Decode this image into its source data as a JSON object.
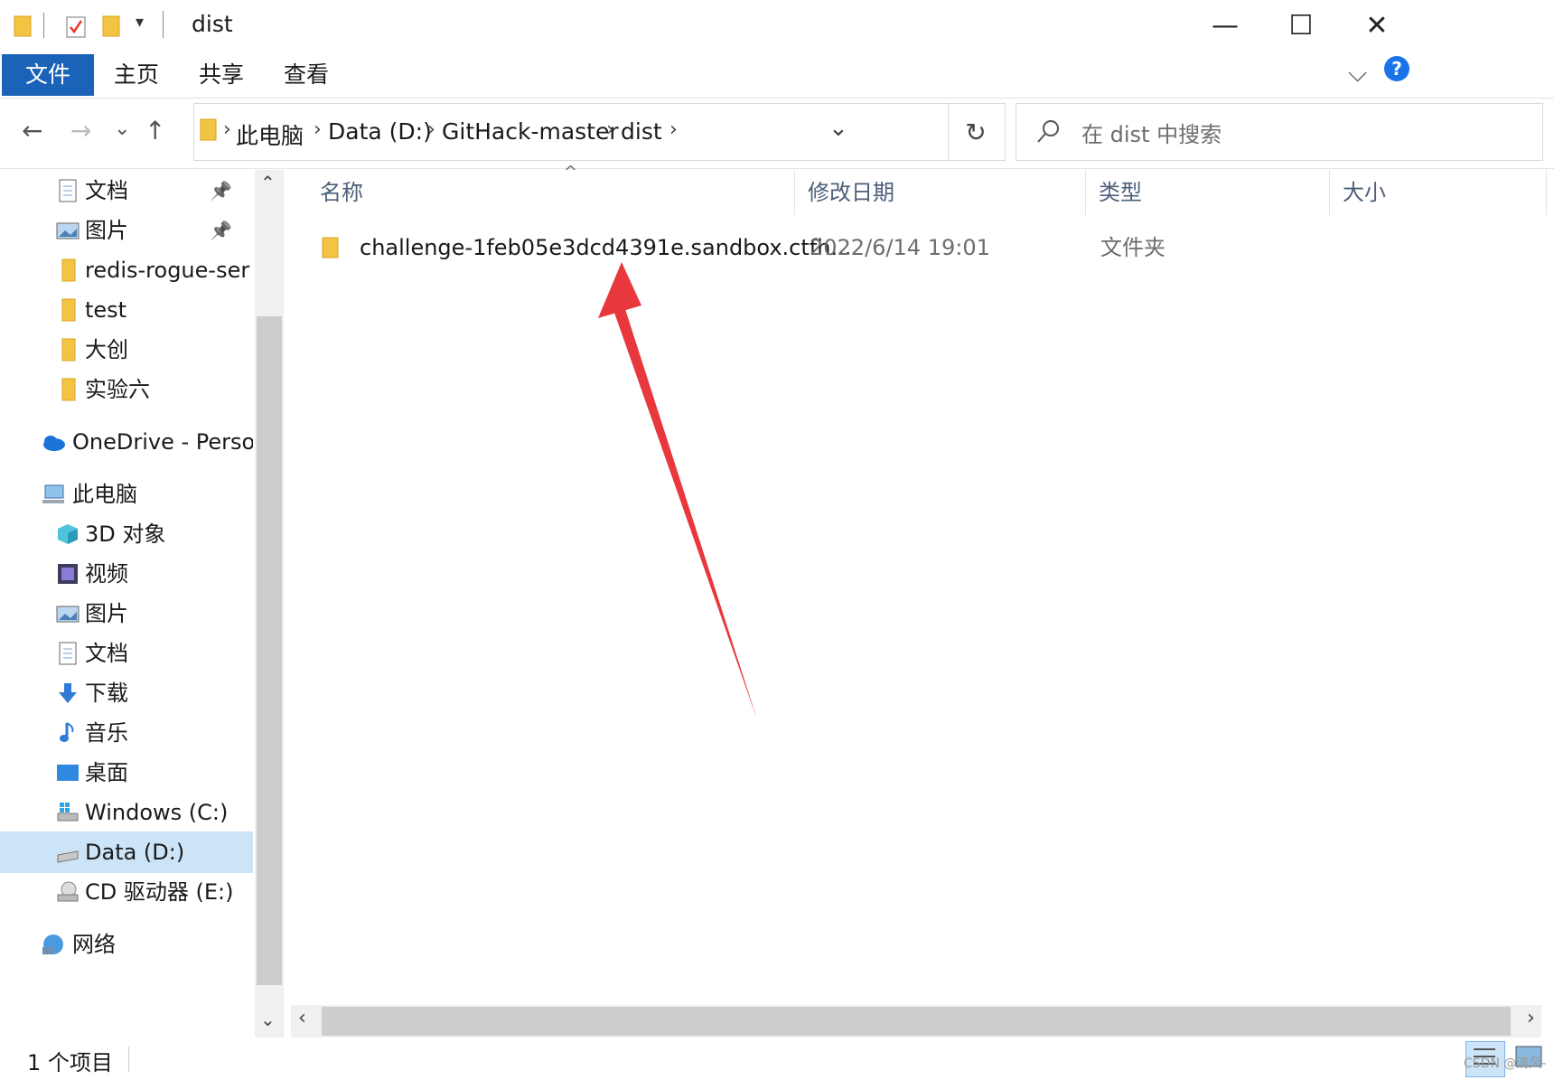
{
  "window": {
    "title": "dist",
    "quick_access": [
      "folder-icon",
      "checkbox-icon",
      "folder-icon",
      "dropdown-icon"
    ],
    "controls": {
      "minimize": "—",
      "maximize": "☐",
      "close": "✕"
    }
  },
  "ribbon": {
    "tabs": [
      {
        "label": "文件",
        "active": true
      },
      {
        "label": "主页",
        "active": false
      },
      {
        "label": "共享",
        "active": false
      },
      {
        "label": "查看",
        "active": false
      }
    ],
    "expand_icon": "⌵",
    "help_icon": "?"
  },
  "nav": {
    "back": "←",
    "forward": "→",
    "recent": "⌄",
    "up": "↑"
  },
  "address": {
    "crumbs": [
      "此电脑",
      "Data (D:)",
      "GitHack-master",
      "dist"
    ],
    "dropdown": "⌄",
    "refresh": "↻"
  },
  "search": {
    "placeholder": "在 dist 中搜索"
  },
  "sidebar": {
    "items": [
      {
        "label": "文档",
        "icon": "document-icon",
        "pinned": true,
        "indent": 1
      },
      {
        "label": "图片",
        "icon": "picture-icon",
        "pinned": true,
        "indent": 1
      },
      {
        "label": "redis-rogue-ser",
        "icon": "folder-icon",
        "pinned": false,
        "indent": 1
      },
      {
        "label": "test",
        "icon": "folder-icon",
        "pinned": false,
        "indent": 1
      },
      {
        "label": "大创",
        "icon": "folder-icon",
        "pinned": false,
        "indent": 1
      },
      {
        "label": "实验六",
        "icon": "folder-icon",
        "pinned": false,
        "indent": 1
      },
      {
        "label": "OneDrive - Perso",
        "icon": "onedrive-icon",
        "pinned": false,
        "indent": 0
      },
      {
        "label": "此电脑",
        "icon": "computer-icon",
        "pinned": false,
        "indent": 0
      },
      {
        "label": "3D 对象",
        "icon": "cube-icon",
        "pinned": false,
        "indent": 1
      },
      {
        "label": "视频",
        "icon": "video-icon",
        "pinned": false,
        "indent": 1
      },
      {
        "label": "图片",
        "icon": "picture-icon",
        "pinned": false,
        "indent": 1
      },
      {
        "label": "文档",
        "icon": "document-icon",
        "pinned": false,
        "indent": 1
      },
      {
        "label": "下载",
        "icon": "download-icon",
        "pinned": false,
        "indent": 1
      },
      {
        "label": "音乐",
        "icon": "music-icon",
        "pinned": false,
        "indent": 1
      },
      {
        "label": "桌面",
        "icon": "desktop-icon",
        "pinned": false,
        "indent": 1
      },
      {
        "label": "Windows (C:)",
        "icon": "windows-drive-icon",
        "pinned": false,
        "indent": 1
      },
      {
        "label": "Data (D:)",
        "icon": "drive-icon",
        "pinned": false,
        "indent": 1,
        "selected": true
      },
      {
        "label": "CD 驱动器 (E:)",
        "icon": "cd-drive-icon",
        "pinned": false,
        "indent": 1
      },
      {
        "label": "网络",
        "icon": "network-icon",
        "pinned": false,
        "indent": 0
      }
    ]
  },
  "columns": [
    "名称",
    "修改日期",
    "类型",
    "大小"
  ],
  "files": [
    {
      "name": "challenge-1feb05e3dcd4391e.sandbox.ctfh...",
      "modified": "2022/6/14 19:01",
      "type": "文件夹",
      "size": ""
    }
  ],
  "status": {
    "count": "1 个项目",
    "watermark": "CSDN @清风-"
  },
  "colors": {
    "accent": "#1a63b8",
    "selected": "#cce4f7",
    "arrow": "#e8383d",
    "folder": "#f3c342"
  }
}
